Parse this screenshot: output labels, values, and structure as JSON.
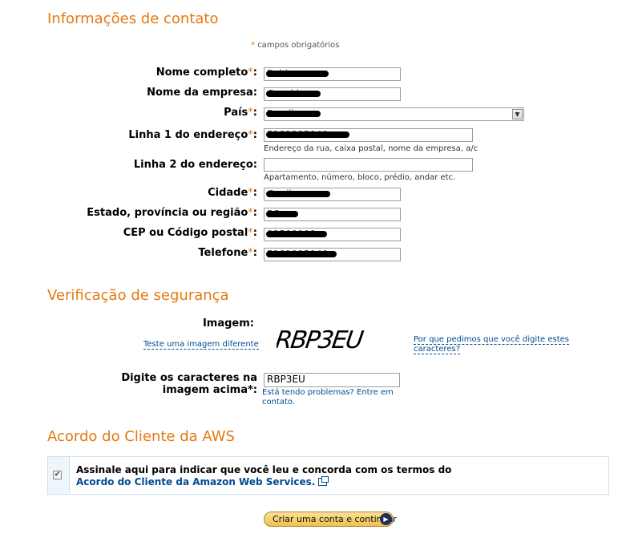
{
  "contact": {
    "heading": "Informações de contato",
    "required_note": "campos obrigatórios",
    "required_star": "*",
    "fields": {
      "full_name": {
        "label": "Nome completo",
        "value": "Robinson"
      },
      "company": {
        "label": "Nome da empresa:",
        "value": "Guarida"
      },
      "country": {
        "label": "País",
        "value": "Brazil"
      },
      "address1": {
        "label": "Linha 1 do endereço",
        "value": "5181995940",
        "hint": "Endereço da rua, caixa postal, nome da empresa, a/c"
      },
      "address2": {
        "label": "Linha 2 do endereço:",
        "value": "",
        "hint": "Apartamento, número, bloco, prédio, andar etc."
      },
      "city": {
        "label": "Cidade",
        "value": "Guaiba"
      },
      "state": {
        "label": "Estado, província ou região",
        "value": "RS"
      },
      "zip": {
        "label": "CEP ou Código postal",
        "value": "92500000"
      },
      "phone": {
        "label": "Telefone",
        "value": "5181995940"
      }
    }
  },
  "security": {
    "heading": "Verificação de segurança",
    "image_label": "Imagem:",
    "try_another": "Teste uma imagem diferente",
    "captcha_text": "RBP3EU",
    "why_line1": "Por que pedimos que você digite estes",
    "why_line2": "caracteres?",
    "type_label_line1": "Digite os caracteres na",
    "type_label_line2": "imagem acima*:",
    "value": "RBP3EU",
    "problems_line1": "Está tendo problemas? Entre em",
    "problems_line2": "contato."
  },
  "agreement": {
    "heading": "Acordo do Cliente da AWS",
    "text": "Assinale aqui para indicar que você leu e concorda com os termos do",
    "link": "Acordo do Cliente da Amazon Web Services.",
    "checked": true
  },
  "submit": {
    "label": "Criar uma conta e continuar",
    "arrow_icon": "play-arrow-icon"
  },
  "colors": {
    "accent": "#e47911",
    "link": "#004b91",
    "box_border": "#c9e1f4"
  }
}
